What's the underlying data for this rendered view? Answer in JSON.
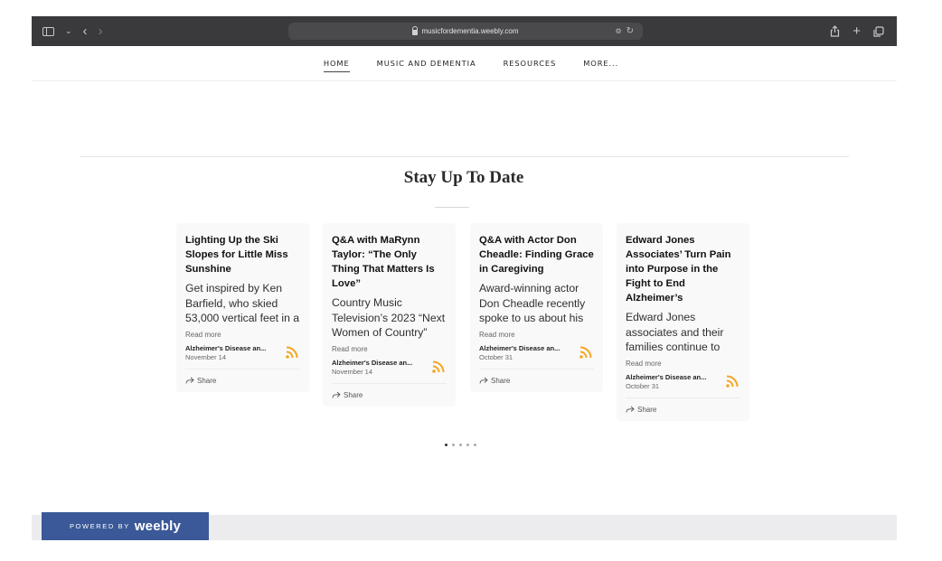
{
  "browser": {
    "url": "musicfordementia.weebly.com",
    "url_extra_icon": "translate-icon",
    "reload_icon": "reload-icon"
  },
  "nav": {
    "items": [
      "HOME",
      "MUSIC AND DEMENTIA",
      "RESOURCES",
      "MORE..."
    ],
    "active_index": 0
  },
  "section": {
    "title": "Stay Up To Date"
  },
  "cards": [
    {
      "title": "Lighting Up the Ski Slopes for Little Miss Sunshine",
      "excerpt": "Get inspired by Ken Barfield, who skied 53,000 vertical feet in a",
      "read_more": "Read more",
      "source": "Alzheimer's Disease an...",
      "date": "November 14",
      "share": "Share"
    },
    {
      "title": "Q&A with MaRynn Taylor: “The Only Thing That Matters Is Love”",
      "excerpt": "Country Music Television’s 2023 “Next Women of Country”",
      "read_more": "Read more",
      "source": "Alzheimer's Disease an...",
      "date": "November 14",
      "share": "Share"
    },
    {
      "title": "Q&A with Actor Don Cheadle: Finding Grace in Caregiving",
      "excerpt": "Award-winning actor Don Cheadle recently spoke to us about his",
      "read_more": "Read more",
      "source": "Alzheimer's Disease an...",
      "date": "October 31",
      "share": "Share"
    },
    {
      "title": "Edward Jones Associates’ Turn Pain into Purpose in the Fight to End Alzheimer’s",
      "excerpt": "Edward Jones associates and their families continue to",
      "read_more": "Read more",
      "source": "Alzheimer's Disease an...",
      "date": "October 31",
      "share": "Share"
    }
  ],
  "carousel": {
    "total": 5,
    "active": 0
  },
  "footer": {
    "powered_by": "POWERED BY",
    "brand": "weebly"
  },
  "colors": {
    "rss": "#f5a623",
    "badge": "#3b5998"
  }
}
